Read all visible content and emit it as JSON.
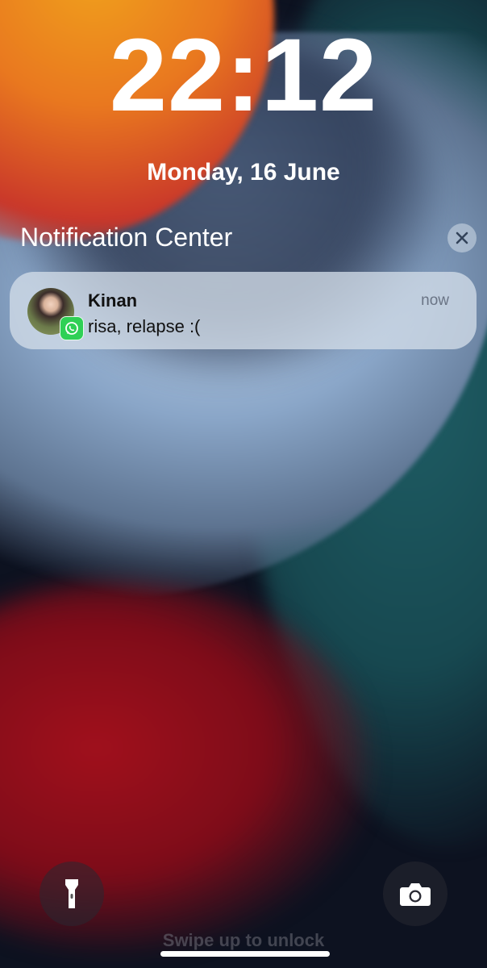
{
  "lockscreen": {
    "time": "22:12",
    "date": "Monday, 16 June"
  },
  "notification_center": {
    "title": "Notification Center",
    "close_icon": "close-icon"
  },
  "notification": {
    "sender": "Kinan",
    "message": "risa, relapse :(",
    "time": "now",
    "app_icon": "whatsapp-icon",
    "app_color": "#2fd055"
  },
  "quick_actions": {
    "left_icon": "flashlight-icon",
    "right_icon": "camera-icon"
  },
  "swipe_hint": "Swipe up to unlock"
}
